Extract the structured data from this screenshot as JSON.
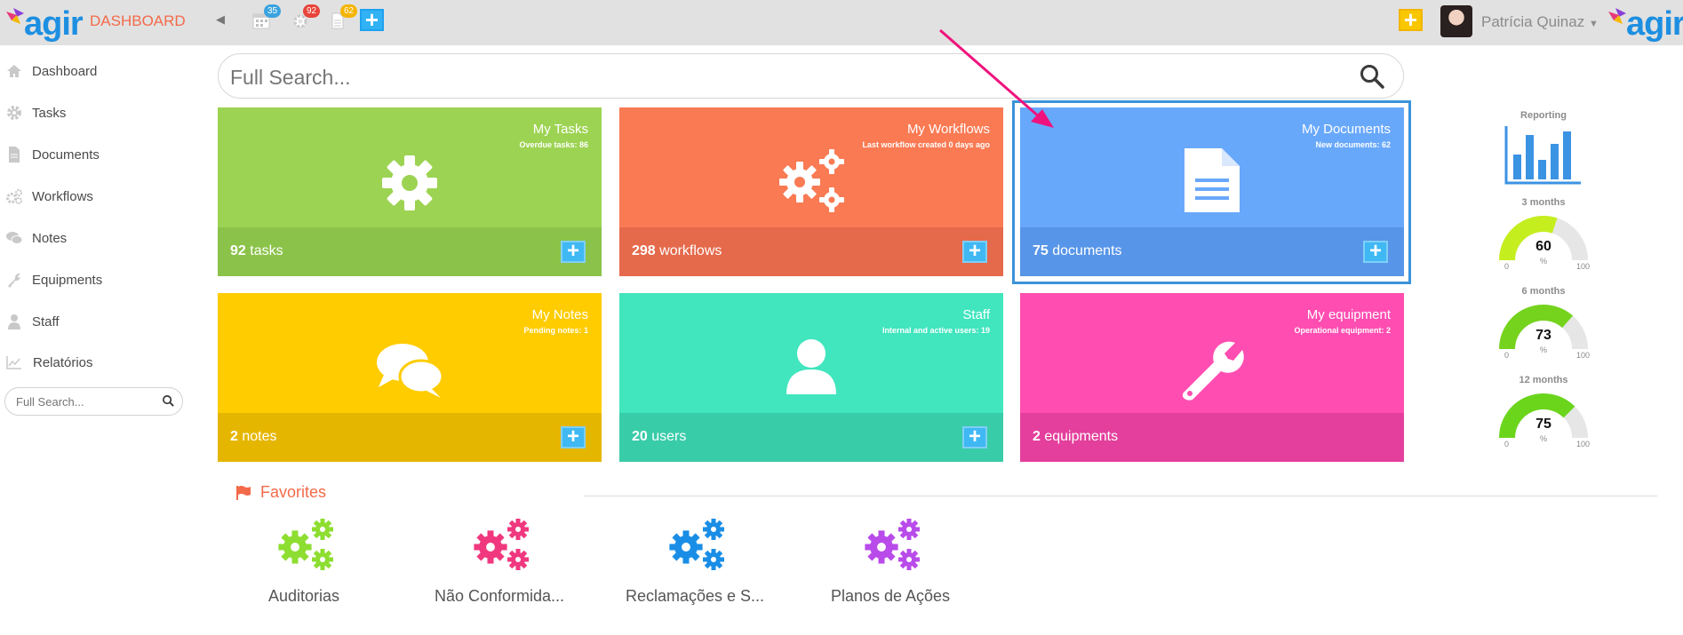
{
  "header": {
    "brand": "agir",
    "title": "DASHBOARD",
    "badges": {
      "calendar": "35",
      "workflows": "92",
      "documents": "62"
    },
    "user_name": "Patrícia Quinaz"
  },
  "sidebar": {
    "items": [
      {
        "label": "Dashboard",
        "icon": "home-icon"
      },
      {
        "label": "Tasks",
        "icon": "gear-icon"
      },
      {
        "label": "Documents",
        "icon": "document-icon"
      },
      {
        "label": "Workflows",
        "icon": "gears-icon"
      },
      {
        "label": "Notes",
        "icon": "comments-icon"
      },
      {
        "label": "Equipments",
        "icon": "wrench-icon"
      },
      {
        "label": "Staff",
        "icon": "user-icon"
      },
      {
        "label": "Relatórios",
        "icon": "chart-icon"
      }
    ],
    "search_placeholder": "Full Search..."
  },
  "search": {
    "placeholder": "Full Search..."
  },
  "tiles": [
    {
      "title": "My Tasks",
      "subtitle": "Overdue tasks: 86",
      "count": "92",
      "unit": " tasks",
      "color": "#9dd353",
      "lower_color": "#8bc34a"
    },
    {
      "title": "My Workflows",
      "subtitle": "Last workflow created 0 days ago",
      "count": "298",
      "unit": " workflows",
      "color": "#f97a53",
      "lower_color": "#e5694b"
    },
    {
      "title": "My Documents",
      "subtitle": "New documents: 62",
      "count": "75",
      "unit": " documents",
      "color": "#68a8fb",
      "lower_color": "#5795e8"
    },
    {
      "title": "My Notes",
      "subtitle": "Pending notes: 1",
      "count": "2",
      "unit": " notes",
      "color": "#ffcc00",
      "lower_color": "#e5b600"
    },
    {
      "title": "Staff",
      "subtitle": "Internal and active users: 19",
      "count": "20",
      "unit": " users",
      "color": "#41e5be",
      "lower_color": "#39cca9"
    },
    {
      "title": "My equipment",
      "subtitle": "Operational equipment: 2",
      "count": "2",
      "unit": " equipments",
      "color": "#ff4db1",
      "lower_color": "#e43f9c"
    }
  ],
  "reporting": {
    "title": "Reporting",
    "gauges": [
      {
        "label": "3 months",
        "value": 60,
        "display": "60",
        "unit": "%",
        "min": "0",
        "max": "100",
        "color": "#c5ee1f"
      },
      {
        "label": "6 months",
        "value": 73,
        "display": "73",
        "unit": "%",
        "min": "0",
        "max": "100",
        "color": "#75d31d"
      },
      {
        "label": "12 months",
        "value": 75,
        "display": "75",
        "unit": "%",
        "min": "0",
        "max": "100",
        "color": "#6bd51c"
      }
    ]
  },
  "favorites": {
    "title": "Favorites",
    "items": [
      {
        "label": "Auditorias",
        "color": "#8ede32"
      },
      {
        "label": "Não Conformida...",
        "color": "#f0387f"
      },
      {
        "label": "Reclamações e S...",
        "color": "#1a8ee6"
      },
      {
        "label": "Planos de Ações",
        "color": "#b94bea"
      }
    ]
  }
}
